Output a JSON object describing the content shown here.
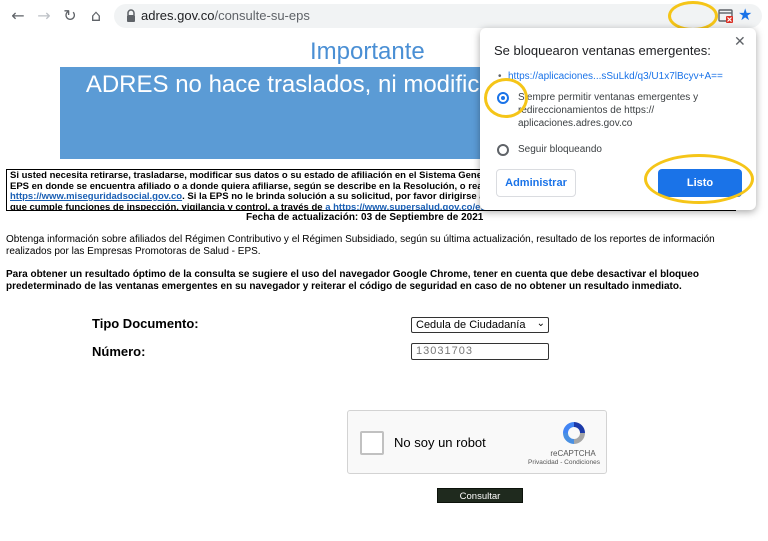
{
  "browser": {
    "url_domain": "adres.gov.co",
    "url_path": "/consulte-su-eps",
    "icons": {
      "back": "arrow-left-icon",
      "forward": "arrow-right-icon",
      "reload": "reload-icon",
      "home": "home-icon",
      "lock": "lock-icon",
      "popup_blocked": "popup-blocked-icon",
      "bookmark": "star-icon"
    }
  },
  "page": {
    "important_title": "Importante",
    "banner_text": "ADRES no hace traslados, ni modificaciones en las EPS.",
    "notice": {
      "part1": "Si usted necesita retirarse, trasladarse, modificar sus datos o su estado de afiliación en el Sistema General de Seguridad Social en Salud, debe acercarse a la EPS en donde se encuentra afiliado o a donde quiera afiliarse, según se describe en la Resolución, o realizar los trámites a través del portal ",
      "link1": "https://www.miseguridadsocial.gov.co",
      "part2": ". Si la EPS no le brinda solución a su solicitud, por favor dirigirse a la Superintendencia Nacional de Salud, organismo que cumple funciones de inspección, vigilancia y control, a través de ",
      "link2": "a https://www.supersalud.gov.co/es-co/atencion-ciudadano/contactenos",
      "part3": "."
    },
    "fecha": "Fecha de actualización: 03 de Septiembre de 2021",
    "paragraph1": "Obtenga información sobre afiliados del Régimen Contributivo y el Régimen Subsidiado, según su última actualización, resultado de los reportes de información realizados por las Empresas Promotoras de Salud - EPS.",
    "paragraph2": "Para obtener un resultado óptimo de la consulta se sugiere el uso del navegador Google Chrome, tener en cuenta que debe desactivar el bloqueo predeterminado de las ventanas emergentes en su navegador y reiterar el código de seguridad en caso de no obtener un resultado inmediato.",
    "form": {
      "tipo_label": "Tipo Documento:",
      "tipo_value": "Cedula de Ciudadanía",
      "numero_label": "Número:",
      "numero_value": "13031703"
    },
    "captcha": {
      "label": "No soy un robot",
      "brand": "reCAPTCHA",
      "links": "Privacidad - Condiciones"
    },
    "submit_label": "Consultar"
  },
  "popup_bubble": {
    "title": "Se bloquearon ventanas emergentes:",
    "blocked_link": "https://aplicaciones...sSuLkd/q3/U1x7lBcyv+A==",
    "option_allow": "Siempre permitir ventanas emergentes y redireccionamientos de https:// aplicaciones.adres.gov.co",
    "option_block": "Seguir bloqueando",
    "manage_label": "Administrar",
    "done_label": "Listo",
    "selected_option": "allow"
  },
  "colors": {
    "highlight": "#f5c518",
    "banner": "#5b9bd5",
    "chrome_blue": "#1a73e8",
    "title_blue": "#4a8fd4"
  }
}
